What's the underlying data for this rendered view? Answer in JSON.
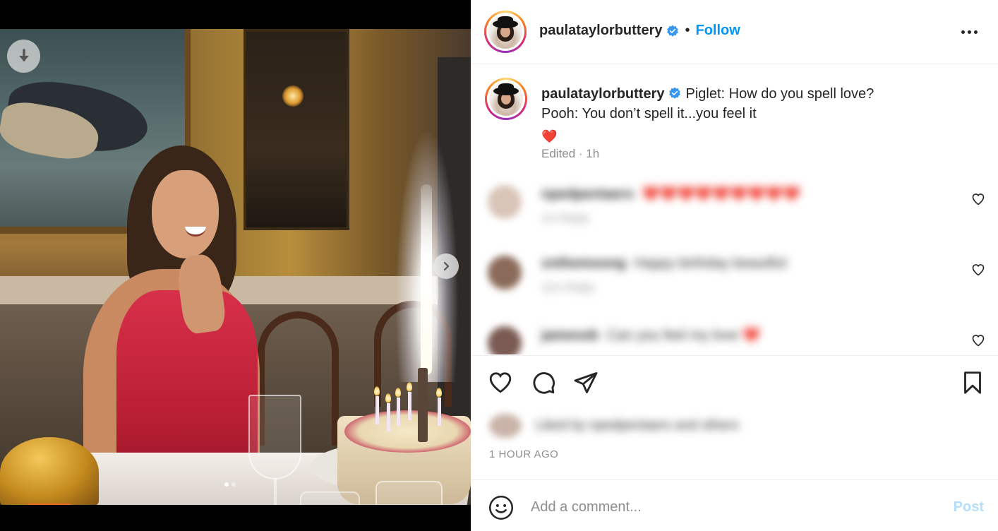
{
  "post": {
    "username": "paulataylorbuttery",
    "follow_label": "Follow",
    "bullet": "•",
    "caption_lines": [
      "Piglet: How do you spell love?",
      "Pooh: You don’t spell it...you feel it"
    ],
    "caption_emoji": "❤️",
    "caption_meta": "Edited · 1h",
    "timestamp": "1 HOUR AGO",
    "carousel": {
      "current": 1,
      "total": 2
    }
  },
  "comments": [
    {
      "user": "npedpentaers",
      "text": "❤️❤️❤️❤️❤️❤️❤️❤️❤️",
      "sub": "1m   Reply"
    },
    {
      "user": "xnthemoong",
      "text": "Happy birthday beautiful",
      "sub": "11m   Reply"
    },
    {
      "user": "jamesob",
      "text": "Can you feel my love ❤️",
      "sub": ""
    }
  ],
  "likes_text": "Liked by npedpentaers and others",
  "add_comment": {
    "placeholder": "Add a comment...",
    "post_label": "Post"
  },
  "colors": {
    "accent": "#0095f6",
    "verified": "#3897f0",
    "post_disabled": "#b2dffc"
  },
  "icons": {
    "download": "arrow-down-icon",
    "next": "chevron-right-icon",
    "like": "heart-icon",
    "comment": "comment-icon",
    "share": "paper-plane-icon",
    "save": "bookmark-icon",
    "emoji": "smiley-icon",
    "more": "ellipsis-icon"
  }
}
